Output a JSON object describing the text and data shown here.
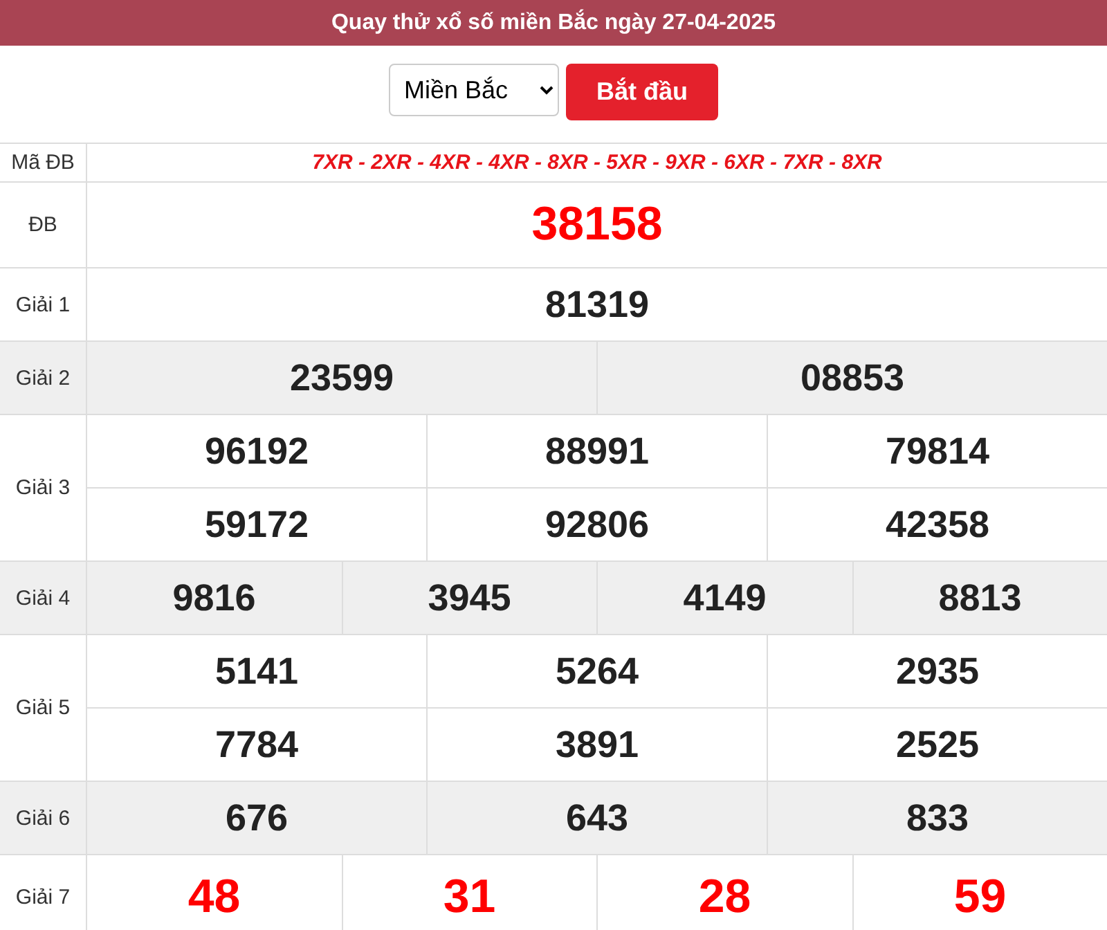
{
  "header": {
    "title": "Quay thử xổ số miền Bắc ngày 27-04-2025"
  },
  "controls": {
    "region_select": "Miền Bắc",
    "start_button": "Bắt đầu"
  },
  "code_row": {
    "label": "Mã ĐB",
    "codes": "7XR - 2XR - 4XR - 4XR - 8XR - 5XR - 9XR - 6XR - 7XR - 8XR"
  },
  "prizes": [
    {
      "label": "ĐB",
      "highlight": true,
      "shaded": false,
      "lines": [
        [
          "38158"
        ]
      ]
    },
    {
      "label": "Giải 1",
      "highlight": false,
      "shaded": false,
      "lines": [
        [
          "81319"
        ]
      ]
    },
    {
      "label": "Giải 2",
      "highlight": false,
      "shaded": true,
      "lines": [
        [
          "23599",
          "08853"
        ]
      ]
    },
    {
      "label": "Giải 3",
      "highlight": false,
      "shaded": false,
      "lines": [
        [
          "96192",
          "88991",
          "79814"
        ],
        [
          "59172",
          "92806",
          "42358"
        ]
      ]
    },
    {
      "label": "Giải 4",
      "highlight": false,
      "shaded": true,
      "lines": [
        [
          "9816",
          "3945",
          "4149",
          "8813"
        ]
      ]
    },
    {
      "label": "Giải 5",
      "highlight": false,
      "shaded": false,
      "lines": [
        [
          "5141",
          "5264",
          "2935"
        ],
        [
          "7784",
          "3891",
          "2525"
        ]
      ]
    },
    {
      "label": "Giải 6",
      "highlight": false,
      "shaded": true,
      "lines": [
        [
          "676",
          "643",
          "833"
        ]
      ]
    },
    {
      "label": "Giải 7",
      "highlight": true,
      "shaded": false,
      "lines": [
        [
          "48",
          "31",
          "28",
          "59"
        ]
      ]
    }
  ]
}
